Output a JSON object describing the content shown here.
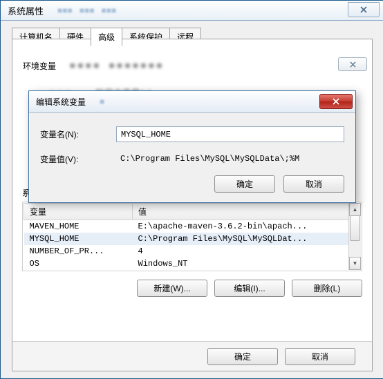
{
  "titlebar": {
    "title": "系统属性"
  },
  "tabs": {
    "t0": "计算机名",
    "t1": "硬件",
    "t2": "高级",
    "t3": "系统保护",
    "t4": "远程"
  },
  "envGroup": {
    "label": "环境变量"
  },
  "dialog": {
    "title": "编辑系统变量",
    "name_label": "变量名(N):",
    "value_label": "变量值(V):",
    "name_value": "MYSQL_HOME",
    "value_value": "C:\\Program Files\\MySQL\\MySQLData\\;%M",
    "ok": "确定",
    "cancel": "取消"
  },
  "sysvar": {
    "group_label": "系统变量(S)",
    "col_var": "变量",
    "col_val": "值",
    "rows": [
      {
        "var": "MAVEN_HOME",
        "val": "E:\\apache-maven-3.6.2-bin\\apach..."
      },
      {
        "var": "MYSQL_HOME",
        "val": "C:\\Program Files\\MySQL\\MySQLDat..."
      },
      {
        "var": "NUMBER_OF_PR...",
        "val": "4"
      },
      {
        "var": "OS",
        "val": "Windows_NT"
      }
    ],
    "btn_new": "新建(W)...",
    "btn_edit": "编辑(I)...",
    "btn_del": "删除(L)"
  },
  "bottom": {
    "ok": "确定",
    "cancel": "取消"
  }
}
